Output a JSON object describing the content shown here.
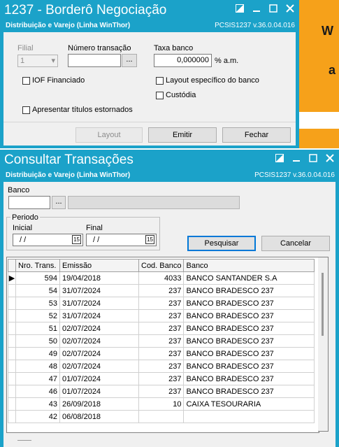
{
  "background": {
    "top_text": "W",
    "mid_text": "a"
  },
  "bordero": {
    "title": "1237 - Borderô Negociação",
    "subtitle": "Distribuição e Varejo (Linha WinThor)",
    "version": "PCSIS1237  v.36.0.04.016",
    "filial_label": "Filial",
    "filial_value": "1",
    "numero_label": "Número transação",
    "numero_value": "",
    "browse_label": "...",
    "taxa_label": "Taxa banco",
    "taxa_value": "0,000000",
    "taxa_unit": "% a.m.",
    "iof_label": "IOF Financiado",
    "layout_banco_label": "Layout específico do banco",
    "custodia_label": "Custódia",
    "estornados_label": "Apresentar títulos estornados",
    "btn_layout": "Layout",
    "btn_emitir": "Emitir",
    "btn_fechar": "Fechar"
  },
  "consultar": {
    "title": "Consultar Transações",
    "subtitle": "Distribuição e Varejo (Linha WinThor)",
    "version": "PCSIS1237  v.36.0.04.016",
    "banco_label": "Banco",
    "banco_code": "",
    "browse_label": "...",
    "periodo_label": "Periodo",
    "inicial_label": "Inicial",
    "inicial_value": "/ /",
    "final_label": "Final",
    "final_value": "/ /",
    "calendar_icon_text": "15",
    "btn_pesquisar": "Pesquisar",
    "btn_cancelar": "Cancelar",
    "columns": [
      "Nro. Trans.",
      "Emissão",
      "Cod. Banco",
      "Banco"
    ],
    "rows": [
      {
        "nro": "594",
        "emissao": "19/04/2018",
        "cod": "4033",
        "banco": "BANCO SANTANDER S.A"
      },
      {
        "nro": "54",
        "emissao": "31/07/2024",
        "cod": "237",
        "banco": "BANCO BRADESCO 237"
      },
      {
        "nro": "53",
        "emissao": "31/07/2024",
        "cod": "237",
        "banco": "BANCO BRADESCO 237"
      },
      {
        "nro": "52",
        "emissao": "31/07/2024",
        "cod": "237",
        "banco": "BANCO BRADESCO 237"
      },
      {
        "nro": "51",
        "emissao": "02/07/2024",
        "cod": "237",
        "banco": "BANCO BRADESCO 237"
      },
      {
        "nro": "50",
        "emissao": "02/07/2024",
        "cod": "237",
        "banco": "BANCO BRADESCO 237"
      },
      {
        "nro": "49",
        "emissao": "02/07/2024",
        "cod": "237",
        "banco": "BANCO BRADESCO 237"
      },
      {
        "nro": "48",
        "emissao": "02/07/2024",
        "cod": "237",
        "banco": "BANCO BRADESCO 237"
      },
      {
        "nro": "47",
        "emissao": "01/07/2024",
        "cod": "237",
        "banco": "BANCO BRADESCO 237"
      },
      {
        "nro": "46",
        "emissao": "01/07/2024",
        "cod": "237",
        "banco": "BANCO BRADESCO 237"
      },
      {
        "nro": "43",
        "emissao": "26/09/2018",
        "cod": "10",
        "banco": "CAIXA TESOURARIA"
      },
      {
        "nro": "42",
        "emissao": "06/08/2018",
        "cod": "",
        "banco": ""
      }
    ]
  },
  "colors": {
    "titlebar": "#1ba2c9",
    "accent": "#f6a11a"
  }
}
